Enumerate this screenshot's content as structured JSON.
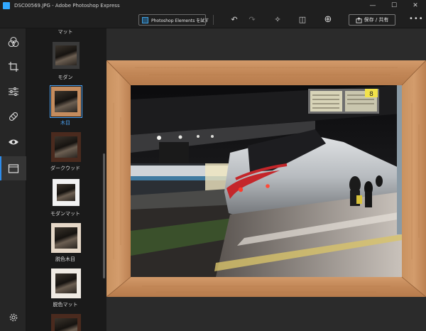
{
  "window": {
    "title": "DSC00569.JPG - Adobe Photoshop Express",
    "minimize_glyph": "—",
    "maximize_glyph": "☐",
    "close_glyph": "✕"
  },
  "toolbar": {
    "pse_label": "Photoshop Elements を試す",
    "undo_glyph": "↶",
    "redo_glyph": "↷",
    "auto_fix_glyph": "✧",
    "compare_glyph": "◫",
    "zoom_glyph": "⊕",
    "save_label": "保存 / 共有",
    "more_glyph": "•••"
  },
  "sidebar": {
    "tools": [
      {
        "icon": "color-looks-icon"
      },
      {
        "icon": "crop-icon"
      },
      {
        "icon": "adjust-sliders-icon"
      },
      {
        "icon": "healing-bandage-icon"
      },
      {
        "icon": "eye-icon"
      },
      {
        "icon": "frame-icon",
        "active": true
      },
      {
        "icon": "settings-gear-icon"
      }
    ]
  },
  "frames_panel": {
    "items": [
      {
        "label": "マット"
      },
      {
        "label": "モダン"
      },
      {
        "label": "木目",
        "selected": true
      },
      {
        "label": "ダークウッド"
      },
      {
        "label": "モダンマット"
      },
      {
        "label": "脱色木目"
      },
      {
        "label": "脱色マット"
      }
    ]
  },
  "canvas": {
    "departure_board_digit": "8"
  },
  "colors": {
    "accent": "#2d8ceb",
    "selected_label": "#4aa0f0",
    "wood": "#c58c5e",
    "background": "#1f1f1f"
  }
}
